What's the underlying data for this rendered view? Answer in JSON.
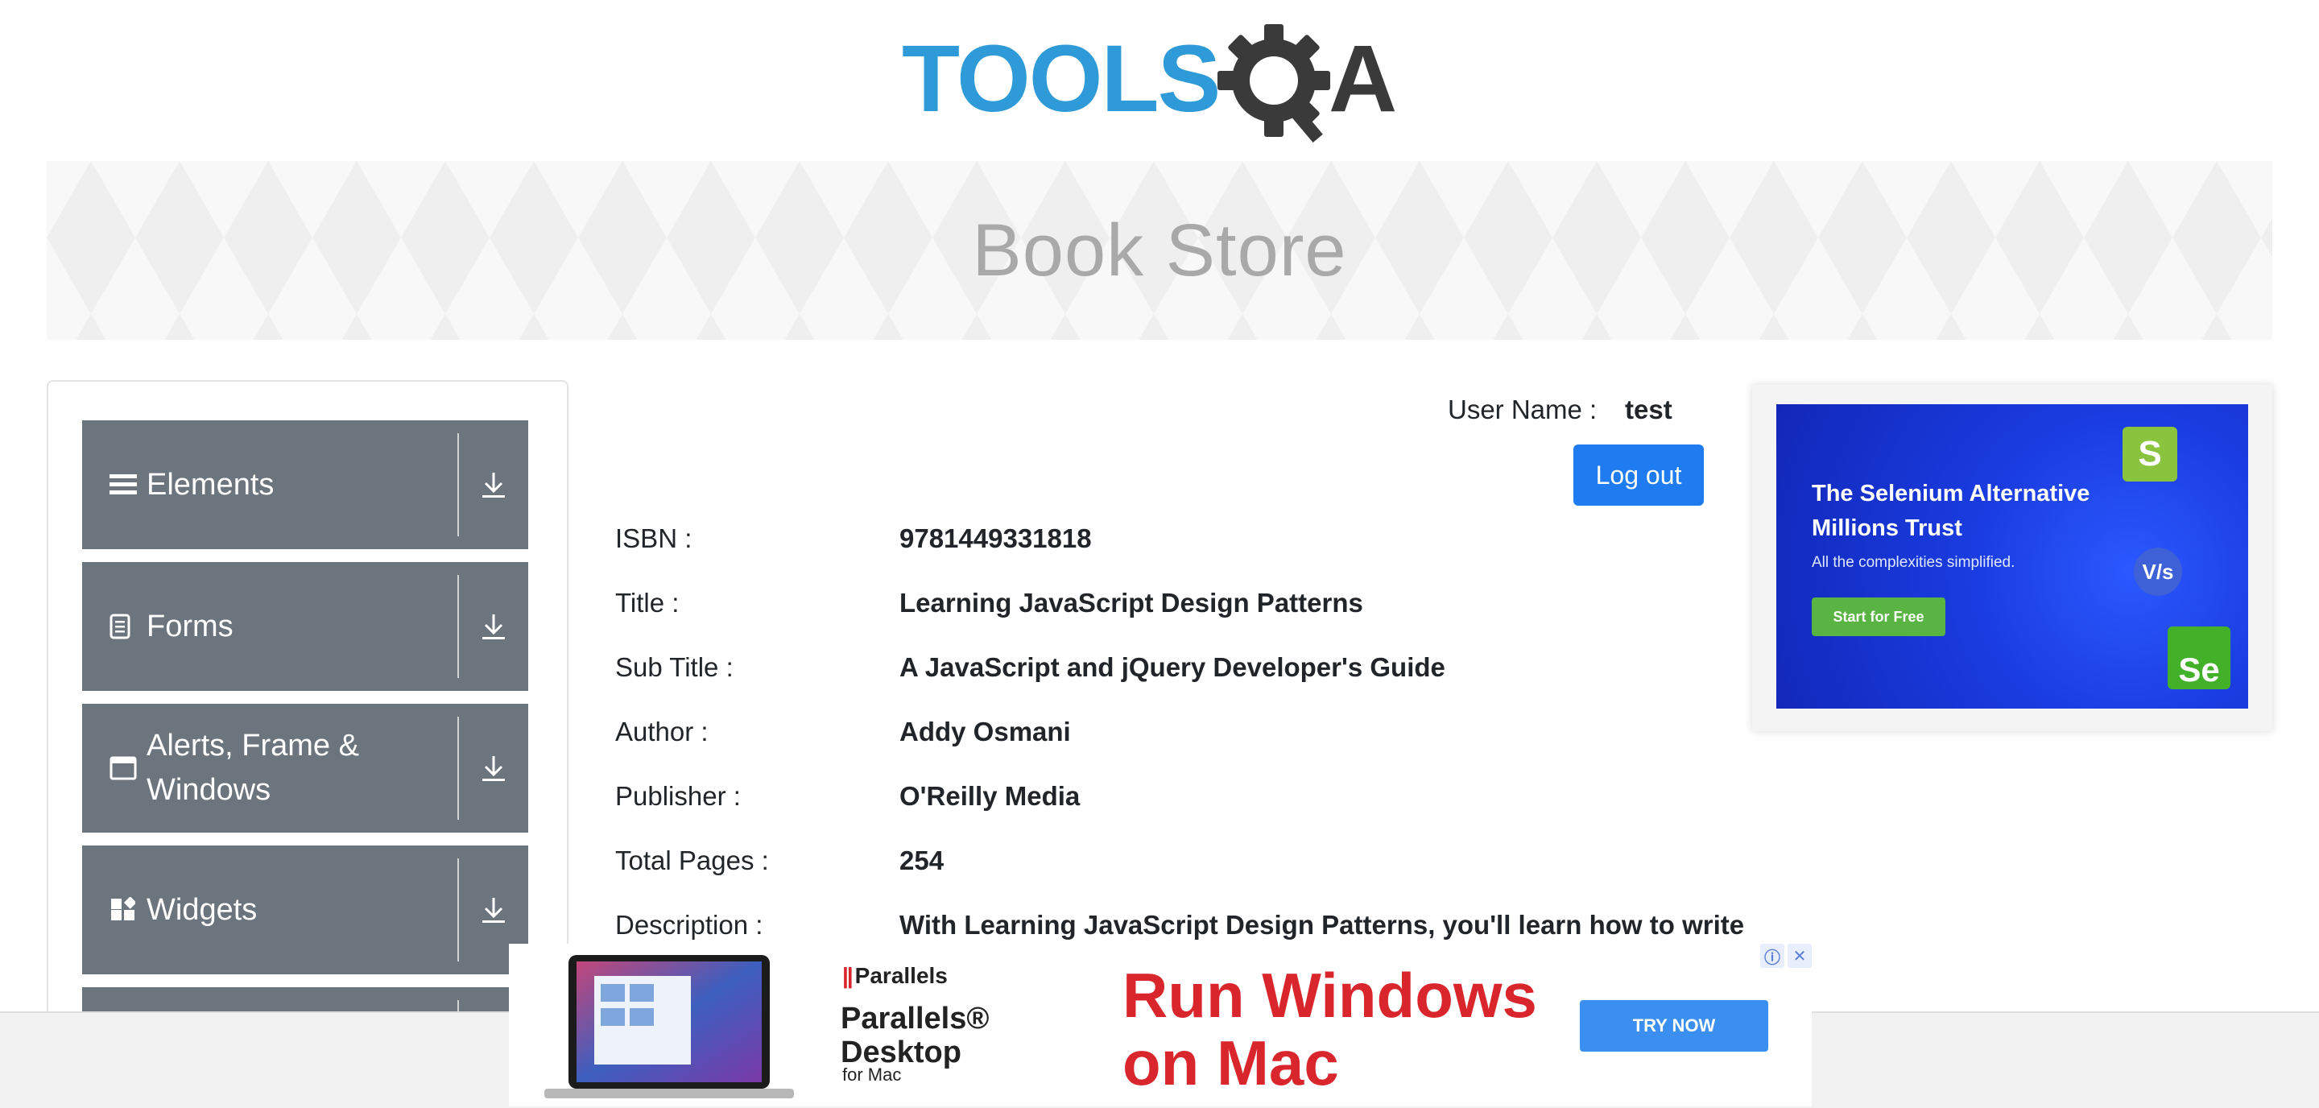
{
  "header": {
    "logo_text_left": "TOOLS",
    "logo_text_right": "A",
    "banner_title": "Book Store"
  },
  "sidebar": {
    "groups": [
      {
        "label": "Elements",
        "icon": "hamburger-icon"
      },
      {
        "label": "Forms",
        "icon": "document-icon"
      },
      {
        "label": "Alerts, Frame & Windows",
        "icon": "window-icon"
      },
      {
        "label": "Widgets",
        "icon": "widgets-icon"
      }
    ]
  },
  "user": {
    "label": "User Name :",
    "value": "test",
    "logout_label": "Log out"
  },
  "book": {
    "isbn": {
      "label": "ISBN :",
      "value": "9781449331818"
    },
    "title": {
      "label": "Title :",
      "value": "Learning JavaScript Design Patterns"
    },
    "subtitle": {
      "label": "Sub Title :",
      "value": "A JavaScript and jQuery Developer's Guide"
    },
    "author": {
      "label": "Author :",
      "value": "Addy Osmani"
    },
    "publisher": {
      "label": "Publisher :",
      "value": "O'Reilly Media"
    },
    "pages": {
      "label": "Total Pages :",
      "value": "254"
    },
    "description": {
      "label": "Description :",
      "value": "With Learning JavaScript Design Patterns, you'll learn how to write"
    }
  },
  "side_ad": {
    "title": "The Selenium Alternative Millions Trust",
    "subtitle": "All the complexities simplified.",
    "cta": "Start for Free",
    "s_badge": "S",
    "vs_badge": "V/s",
    "se_badge": "Se"
  },
  "bottom_ad": {
    "brand_mark": "Parallels",
    "brand_bars": "||",
    "product_line1": "Parallels®",
    "product_line2": "Desktop",
    "product_sub": "for Mac",
    "headline_line1": "Run Windows",
    "headline_line2": "on Mac",
    "cta": "TRY NOW",
    "info_glyph": "ⓘ",
    "close_glyph": "✕"
  },
  "colors": {
    "accent": "#1f7bf0",
    "sidebar_group": "#6c757d",
    "logo_blue": "#2e9ad8",
    "logo_dark": "#3a3a3a",
    "ad_red": "#d9262c"
  }
}
